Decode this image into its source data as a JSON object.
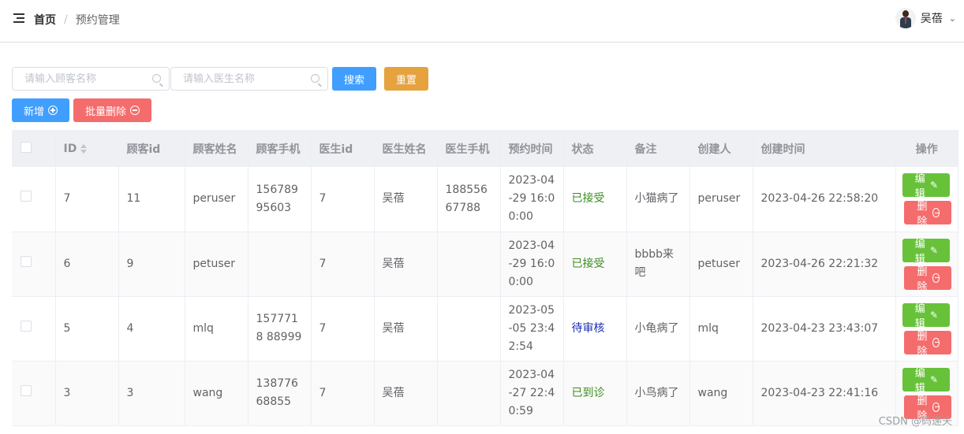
{
  "header": {
    "breadcrumb_home": "首页",
    "breadcrumb_sep": "/",
    "breadcrumb_current": "预约管理",
    "username": "吴蓓",
    "icons": {
      "menu": "menu-fold-icon",
      "chevron": "chevron-down-icon",
      "avatar": "user-avatar"
    }
  },
  "toolbar": {
    "customer_placeholder": "请输入顾客名称",
    "doctor_placeholder": "请输入医生名称",
    "search_label": "搜索",
    "reset_label": "重置",
    "add_label": "新增",
    "batch_delete_label": "批量删除"
  },
  "colors": {
    "primary": "#409eff",
    "warning": "#e6a23c",
    "danger": "#f56c6c",
    "success": "#67c23a",
    "status_accepted": "#3a8c1f",
    "status_pending": "#1f2fb3"
  },
  "table": {
    "columns": [
      "ID",
      "顾客id",
      "顾客姓名",
      "顾客手机",
      "医生id",
      "医生姓名",
      "医生手机",
      "预约时间",
      "状态",
      "备注",
      "创建人",
      "创建时间",
      "操作"
    ],
    "rows": [
      {
        "id": "7",
        "customer_id": "11",
        "customer_name": "peruser",
        "customer_phone": "15678995603",
        "doctor_id": "7",
        "doctor_name": "吴蓓",
        "doctor_phone": "18855667788",
        "appt_time": "2023-04-29 16:00:00",
        "status": "已接受",
        "status_type": "green",
        "note": "小猫病了",
        "creator": "peruser",
        "created_at": "2023-04-26 22:58:20"
      },
      {
        "id": "6",
        "customer_id": "9",
        "customer_name": "petuser",
        "customer_phone": "",
        "doctor_id": "7",
        "doctor_name": "吴蓓",
        "doctor_phone": "",
        "appt_time": "2023-04-29 16:00:00",
        "status": "已接受",
        "status_type": "green",
        "note": "bbbb来吧",
        "creator": "petuser",
        "created_at": "2023-04-26 22:21:32"
      },
      {
        "id": "5",
        "customer_id": "4",
        "customer_name": "mlq",
        "customer_phone": "1577718 88999",
        "doctor_id": "7",
        "doctor_name": "吴蓓",
        "doctor_phone": "",
        "appt_time": "2023-05-05 23:42:54",
        "status": "待审核",
        "status_type": "blue",
        "note": "小龟病了",
        "creator": "mlq",
        "created_at": "2023-04-23 23:43:07"
      },
      {
        "id": "3",
        "customer_id": "3",
        "customer_name": "wang",
        "customer_phone": "13877668855",
        "doctor_id": "7",
        "doctor_name": "吴蓓",
        "doctor_phone": "",
        "appt_time": "2023-04-27 22:40:59",
        "status": "已到诊",
        "status_type": "green",
        "note": "小鸟病了",
        "creator": "wang",
        "created_at": "2023-04-23 22:41:16"
      }
    ],
    "edit_label": "编辑",
    "delete_label": "删除"
  },
  "watermark": "CSDN @码递夫"
}
